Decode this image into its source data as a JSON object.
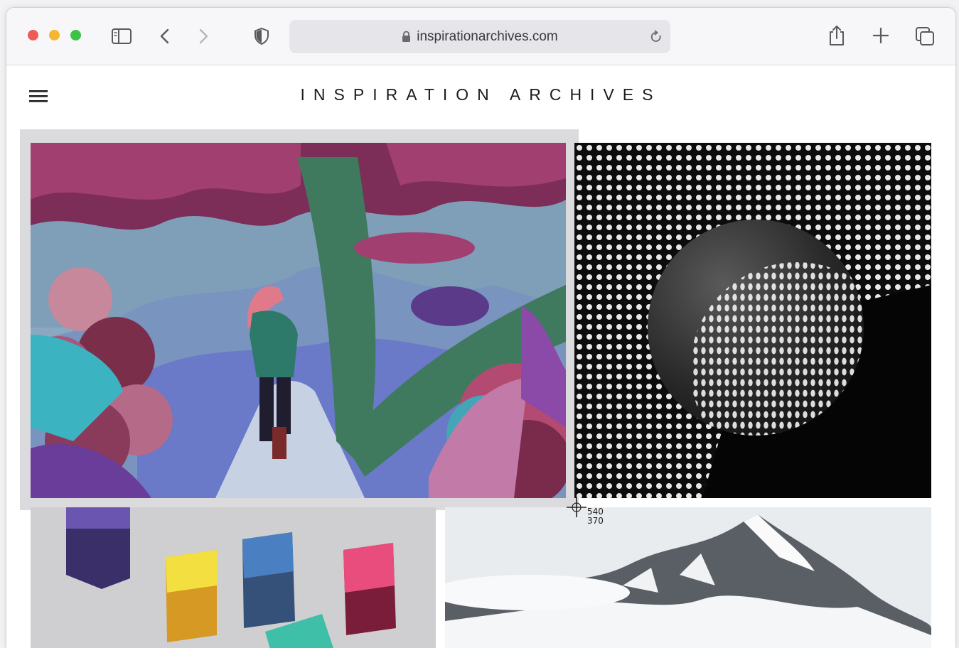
{
  "browser": {
    "address_bar": {
      "url": "inspirationarchives.com"
    },
    "traffic_lights": {
      "close": "#ee5b55",
      "minimize": "#f5b633",
      "zoom": "#3cc245"
    },
    "icons": [
      "sidebar-toggle-icon",
      "back-icon",
      "forward-icon",
      "privacy-shield-icon",
      "lock-icon",
      "reload-icon",
      "share-icon",
      "new-tab-icon",
      "tab-overview-icon"
    ]
  },
  "site": {
    "title": "INSPIRATION ARCHIVES",
    "menu_icon": "hamburger-menu-icon"
  },
  "gallery": {
    "tiles": [
      {
        "subject": "forest-illustration"
      },
      {
        "subject": "dotted-sphere"
      },
      {
        "subject": "colored-cubes"
      },
      {
        "subject": "snowy-mountain"
      }
    ]
  },
  "selection": {
    "crosshair_icon": "crosshair-icon",
    "width_readout": "540",
    "height_readout": "370"
  }
}
